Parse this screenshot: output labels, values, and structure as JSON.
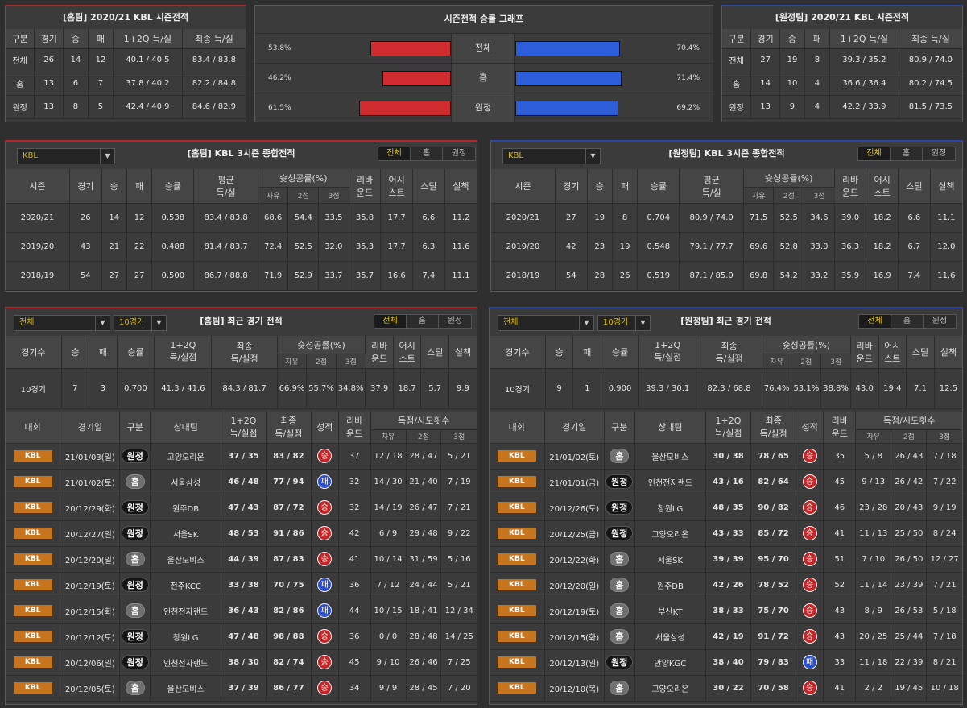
{
  "top_home": {
    "title": "[홈팀] 2020/21 KBL 시즌전적",
    "headers": [
      "구분",
      "경기",
      "승",
      "패",
      "1+2Q 득/실",
      "최종 득/실"
    ],
    "rows": [
      [
        "전체",
        "26",
        "14",
        "12",
        "40.1 / 40.5",
        "83.4 / 83.8"
      ],
      [
        "홈",
        "13",
        "6",
        "7",
        "37.8 / 40.2",
        "82.2 / 84.8"
      ],
      [
        "원정",
        "13",
        "8",
        "5",
        "42.4 / 40.9",
        "84.6 / 82.9"
      ]
    ]
  },
  "top_graph": {
    "title": "시즌전적 승률 그래프",
    "rows": [
      {
        "label": "전체",
        "home_pct": "53.8%",
        "away_pct": "70.4%",
        "home": 53.8,
        "away": 70.4
      },
      {
        "label": "홈",
        "home_pct": "46.2%",
        "away_pct": "71.4%",
        "home": 46.2,
        "away": 71.4
      },
      {
        "label": "원정",
        "home_pct": "61.5%",
        "away_pct": "69.2%",
        "home": 61.5,
        "away": 69.2
      }
    ]
  },
  "top_away": {
    "title": "[원정팀] 2020/21 KBL 시즌전적",
    "headers": [
      "구분",
      "경기",
      "승",
      "패",
      "1+2Q 득/실",
      "최종 득/실"
    ],
    "rows": [
      [
        "전체",
        "27",
        "19",
        "8",
        "39.3 / 35.2",
        "80.9 / 74.0"
      ],
      [
        "홈",
        "14",
        "10",
        "4",
        "36.6 / 36.4",
        "80.2 / 74.5"
      ],
      [
        "원정",
        "13",
        "9",
        "4",
        "42.2 / 33.9",
        "81.5 / 73.5"
      ]
    ]
  },
  "tabs": [
    "전체",
    "홈",
    "원정"
  ],
  "mid_home": {
    "title": "[홈팀] KBL 3시즌 종합전적",
    "select": "KBL",
    "rows": [
      [
        "2020/21",
        "26",
        "14",
        "12",
        "0.538",
        "83.4 / 83.8",
        "68.6",
        "54.4",
        "33.5",
        "35.8",
        "17.7",
        "6.6",
        "11.2"
      ],
      [
        "2019/20",
        "43",
        "21",
        "22",
        "0.488",
        "81.4 / 83.7",
        "72.4",
        "52.5",
        "32.0",
        "35.3",
        "17.7",
        "6.3",
        "11.6"
      ],
      [
        "2018/19",
        "54",
        "27",
        "27",
        "0.500",
        "86.7 / 88.8",
        "71.9",
        "52.9",
        "33.7",
        "35.7",
        "16.6",
        "7.4",
        "11.1"
      ]
    ]
  },
  "mid_away": {
    "title": "[원정팀] KBL 3시즌 종합전적",
    "select": "KBL",
    "rows": [
      [
        "2020/21",
        "27",
        "19",
        "8",
        "0.704",
        "80.9 / 74.0",
        "71.5",
        "52.5",
        "34.6",
        "39.0",
        "18.2",
        "6.6",
        "11.1"
      ],
      [
        "2019/20",
        "42",
        "23",
        "19",
        "0.548",
        "79.1 / 77.7",
        "69.6",
        "52.8",
        "33.0",
        "36.3",
        "18.2",
        "6.7",
        "12.0"
      ],
      [
        "2018/19",
        "54",
        "28",
        "26",
        "0.519",
        "87.1 / 85.0",
        "69.8",
        "54.2",
        "33.2",
        "35.9",
        "16.9",
        "7.4",
        "11.6"
      ]
    ]
  },
  "mid_headers": {
    "season": "시즌",
    "games": "경기",
    "win": "승",
    "loss": "패",
    "rate": "승률",
    "avg1": "평균",
    "avg2": "득/실",
    "shoot": "슛성공률(%)",
    "ft": "자유",
    "two": "2점",
    "three": "3점",
    "reb1": "리바",
    "reb2": "운드",
    "ast1": "어시",
    "ast2": "스트",
    "stl": "스틸",
    "tov": "실책"
  },
  "recent_headers": {
    "count": "경기수",
    "win": "승",
    "loss": "패",
    "rate": "승률",
    "q1": "1+2Q",
    "q2": "득/실점",
    "f1": "최종",
    "f2": "득/실점",
    "shoot": "슛성공률(%)",
    "ft": "자유",
    "two": "2점",
    "three": "3점",
    "reb1": "리바",
    "reb2": "운드",
    "ast1": "어시",
    "ast2": "스트",
    "stl": "스틸",
    "tov": "실책"
  },
  "game_headers": {
    "league": "대회",
    "date": "경기일",
    "type": "구분",
    "opp": "상대팀",
    "q1": "1+2Q",
    "q2": "득/실점",
    "f1": "최종",
    "f2": "득/실점",
    "res": "성적",
    "reb1": "리바",
    "reb2": "운드",
    "att": "득점/시도횟수",
    "ft": "자유",
    "two": "2점",
    "three": "3점"
  },
  "recent_home": {
    "title": "[홈팀] 최근 경기 전적",
    "select1": "전체",
    "select2": "10경기",
    "summary": [
      "10경기",
      "7",
      "3",
      "0.700",
      "41.3 / 41.6",
      "84.3 / 81.7",
      "66.9%",
      "55.7%",
      "34.8%",
      "37.9",
      "18.7",
      "5.7",
      "9.9"
    ],
    "games": [
      [
        "KBL",
        "21/01/03(일)",
        "원정",
        "고양오리온",
        "37 / 35",
        "83 / 82",
        "승",
        "37",
        "12 / 18",
        "28 / 47",
        "5 / 21"
      ],
      [
        "KBL",
        "21/01/02(토)",
        "홈",
        "서울삼성",
        "46 / 48",
        "77 / 94",
        "패",
        "32",
        "14 / 30",
        "21 / 40",
        "7 / 19"
      ],
      [
        "KBL",
        "20/12/29(화)",
        "원정",
        "원주DB",
        "47 / 43",
        "87 / 72",
        "승",
        "32",
        "14 / 19",
        "26 / 47",
        "7 / 21"
      ],
      [
        "KBL",
        "20/12/27(일)",
        "원정",
        "서울SK",
        "48 / 53",
        "91 / 86",
        "승",
        "42",
        "6 / 9",
        "29 / 48",
        "9 / 22"
      ],
      [
        "KBL",
        "20/12/20(일)",
        "홈",
        "울산모비스",
        "44 / 39",
        "87 / 83",
        "승",
        "41",
        "10 / 14",
        "31 / 59",
        "5 / 16"
      ],
      [
        "KBL",
        "20/12/19(토)",
        "원정",
        "전주KCC",
        "33 / 38",
        "70 / 75",
        "패",
        "36",
        "7 / 12",
        "24 / 44",
        "5 / 21"
      ],
      [
        "KBL",
        "20/12/15(화)",
        "홈",
        "인천전자랜드",
        "36 / 43",
        "82 / 86",
        "패",
        "44",
        "10 / 15",
        "18 / 41",
        "12 / 34"
      ],
      [
        "KBL",
        "20/12/12(토)",
        "원정",
        "창원LG",
        "47 / 48",
        "98 / 88",
        "승",
        "36",
        "0 / 0",
        "28 / 48",
        "14 / 25"
      ],
      [
        "KBL",
        "20/12/06(일)",
        "원정",
        "인천전자랜드",
        "38 / 30",
        "82 / 74",
        "승",
        "45",
        "9 / 10",
        "26 / 46",
        "7 / 25"
      ],
      [
        "KBL",
        "20/12/05(토)",
        "홈",
        "울산모비스",
        "37 / 39",
        "86 / 77",
        "승",
        "34",
        "9 / 9",
        "28 / 45",
        "7 / 20"
      ]
    ]
  },
  "recent_away": {
    "title": "[원정팀] 최근 경기 전적",
    "select1": "전체",
    "select2": "10경기",
    "summary": [
      "10경기",
      "9",
      "1",
      "0.900",
      "39.3 / 30.1",
      "82.3 / 68.8",
      "76.4%",
      "53.1%",
      "38.8%",
      "43.0",
      "19.4",
      "7.1",
      "12.5"
    ],
    "games": [
      [
        "KBL",
        "21/01/02(토)",
        "홈",
        "울산모비스",
        "30 / 38",
        "78 / 65",
        "승",
        "35",
        "5 / 8",
        "26 / 43",
        "7 / 18"
      ],
      [
        "KBL",
        "21/01/01(금)",
        "원정",
        "인천전자랜드",
        "43 / 16",
        "82 / 64",
        "승",
        "45",
        "9 / 13",
        "26 / 42",
        "7 / 22"
      ],
      [
        "KBL",
        "20/12/26(토)",
        "원정",
        "창원LG",
        "48 / 35",
        "90 / 82",
        "승",
        "46",
        "23 / 28",
        "20 / 43",
        "9 / 19"
      ],
      [
        "KBL",
        "20/12/25(금)",
        "원정",
        "고양오리온",
        "43 / 33",
        "85 / 72",
        "승",
        "41",
        "11 / 13",
        "25 / 50",
        "8 / 24"
      ],
      [
        "KBL",
        "20/12/22(화)",
        "홈",
        "서울SK",
        "39 / 39",
        "95 / 70",
        "승",
        "51",
        "7 / 10",
        "26 / 50",
        "12 / 27"
      ],
      [
        "KBL",
        "20/12/20(일)",
        "홈",
        "원주DB",
        "42 / 26",
        "78 / 52",
        "승",
        "52",
        "11 / 14",
        "23 / 39",
        "7 / 21"
      ],
      [
        "KBL",
        "20/12/19(토)",
        "홈",
        "부산KT",
        "38 / 33",
        "75 / 70",
        "승",
        "43",
        "8 / 9",
        "26 / 53",
        "5 / 18"
      ],
      [
        "KBL",
        "20/12/15(화)",
        "홈",
        "서울삼성",
        "42 / 19",
        "91 / 72",
        "승",
        "43",
        "20 / 25",
        "25 / 44",
        "7 / 18"
      ],
      [
        "KBL",
        "20/12/13(일)",
        "원정",
        "안양KGC",
        "38 / 40",
        "79 / 83",
        "패",
        "33",
        "11 / 18",
        "22 / 39",
        "8 / 21"
      ],
      [
        "KBL",
        "20/12/10(목)",
        "홈",
        "고양오리온",
        "30 / 22",
        "70 / 58",
        "승",
        "41",
        "2 / 2",
        "19 / 45",
        "10 / 18"
      ]
    ]
  },
  "colors": {
    "home_bar": "#d02b2f",
    "away_bar": "#2b5ed8",
    "kbl_badge": "#c7741f",
    "win": "#c0282a",
    "loss": "#2a4fc9",
    "active_tab": "#e3c400"
  }
}
